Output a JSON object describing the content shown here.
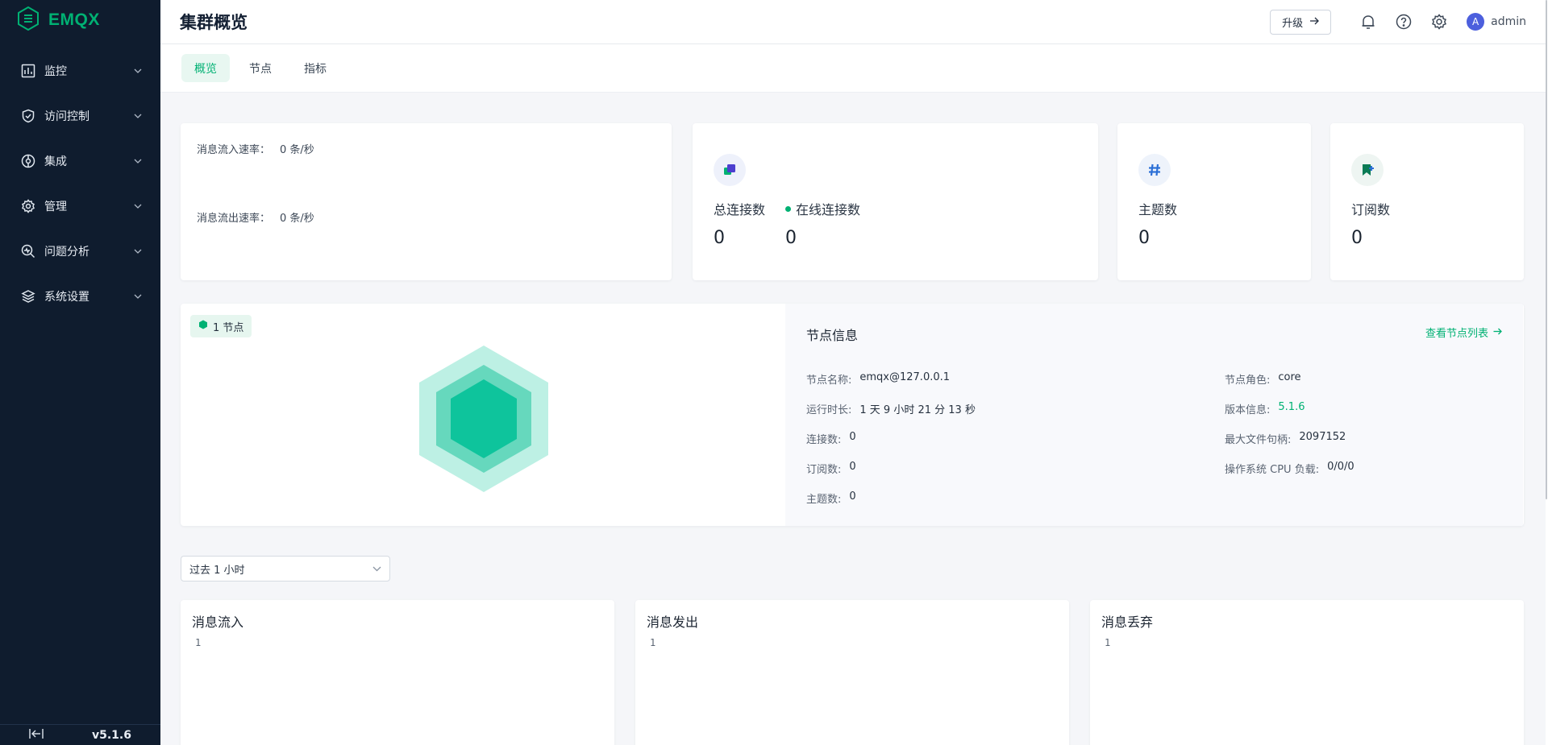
{
  "sidebar": {
    "brand": "EMQX",
    "items": [
      {
        "label": "监控"
      },
      {
        "label": "访问控制"
      },
      {
        "label": "集成"
      },
      {
        "label": "管理"
      },
      {
        "label": "问题分析"
      },
      {
        "label": "系统设置"
      }
    ],
    "version": "v5.1.6"
  },
  "header": {
    "title": "集群概览",
    "upgrade_label": "升级",
    "user": "admin",
    "avatar_letter": "A"
  },
  "tabs": [
    {
      "label": "概览",
      "active": true
    },
    {
      "label": "节点",
      "active": false
    },
    {
      "label": "指标",
      "active": false
    }
  ],
  "rates": {
    "in_label": "消息流入速率：",
    "in_value": "0 条/秒",
    "out_label": "消息流出速率：",
    "out_value": "0 条/秒"
  },
  "stats": {
    "connections": {
      "total_label": "总连接数",
      "total_value": "0",
      "online_label": "在线连接数",
      "online_value": "0"
    },
    "topics": {
      "label": "主题数",
      "value": "0"
    },
    "subscriptions": {
      "label": "订阅数",
      "value": "0"
    }
  },
  "node": {
    "badge": "1 节点",
    "info_title": "节点信息",
    "view_list": "查看节点列表",
    "left": [
      {
        "label": "节点名称:",
        "value": "emqx@127.0.0.1"
      },
      {
        "label": "运行时长:",
        "value": "1 天 9 小时 21 分 13 秒"
      },
      {
        "label": "连接数:",
        "value": "0"
      },
      {
        "label": "订阅数:",
        "value": "0"
      },
      {
        "label": "主题数:",
        "value": "0"
      }
    ],
    "right": [
      {
        "label": "节点角色:",
        "value": "core"
      },
      {
        "label": "版本信息:",
        "value": "5.1.6"
      },
      {
        "label": "最大文件句柄:",
        "value": "2097152"
      },
      {
        "label": "操作系统 CPU 负载:",
        "value": "0/0/0"
      }
    ]
  },
  "time_range": {
    "value": "过去 1 小时"
  },
  "charts": [
    {
      "title": "消息流入",
      "y_tick": "1"
    },
    {
      "title": "消息发出",
      "y_tick": "1"
    },
    {
      "title": "消息丢弃",
      "y_tick": "1"
    }
  ],
  "colors": {
    "accent": "#00b173",
    "sidebar_bg": "#0f1c2e",
    "avatar": "#4c5fdd"
  }
}
